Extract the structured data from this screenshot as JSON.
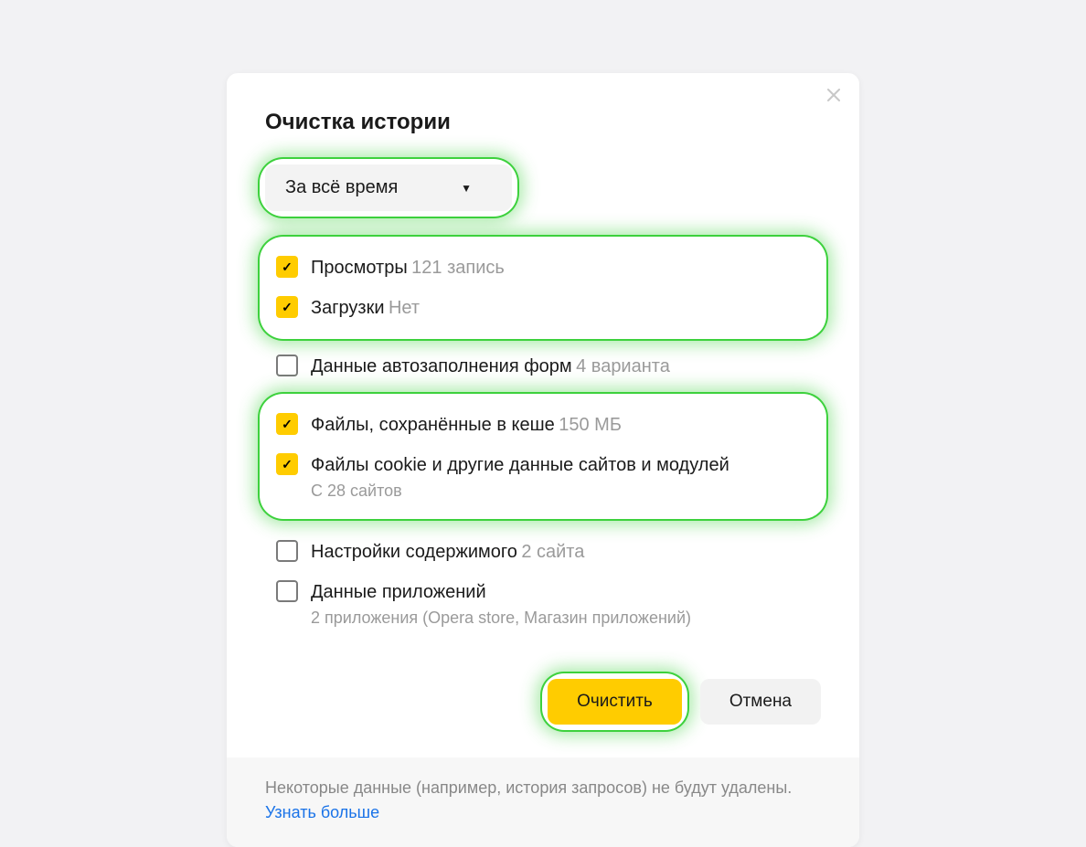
{
  "title": "Очистка истории",
  "range": {
    "selected": "За всё время"
  },
  "options": {
    "views": {
      "label": "Просмотры",
      "hint": "121 запись"
    },
    "downloads": {
      "label": "Загрузки",
      "hint": "Нет"
    },
    "autofill": {
      "label": "Данные автозаполнения форм",
      "hint": "4 варианта"
    },
    "cache": {
      "label": "Файлы, сохранённые в кеше",
      "hint": "150 МБ"
    },
    "cookies": {
      "label": "Файлы cookie и другие данные сайтов и модулей",
      "sub": "С 28 сайтов"
    },
    "content": {
      "label": "Настройки содержимого",
      "hint": "2 сайта"
    },
    "apps": {
      "label": "Данные приложений",
      "sub": "2 приложения (Opera store, Магазин приложений)"
    }
  },
  "buttons": {
    "clear": "Очистить",
    "cancel": "Отмена"
  },
  "footer": {
    "note": "Некоторые данные (например, история запросов) не будут удалены.",
    "link": "Узнать больше"
  }
}
